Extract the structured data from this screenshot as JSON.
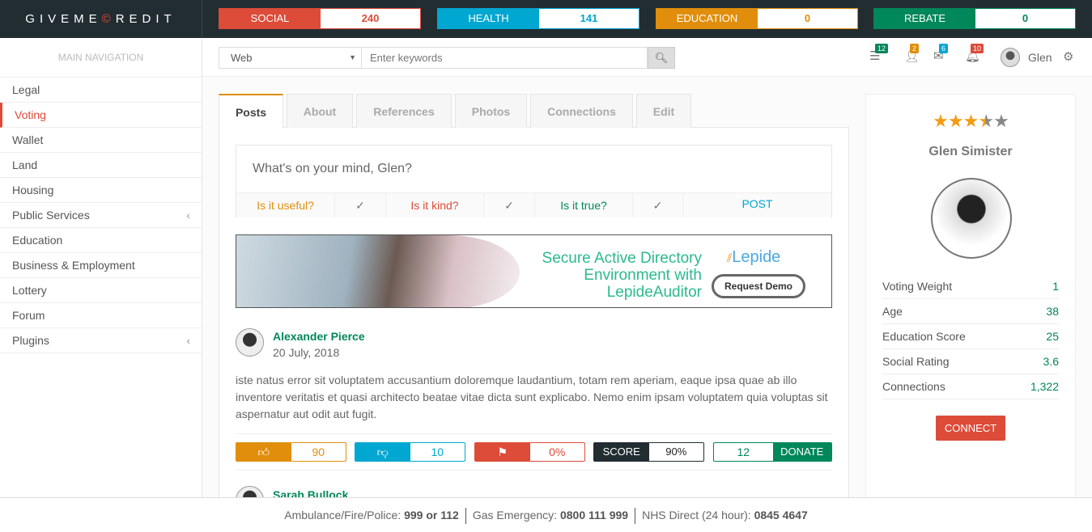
{
  "logo": {
    "pre": "GIVEME",
    "mark": "©",
    "post": "REDIT"
  },
  "stats": [
    {
      "label": "SOCIAL",
      "value": "240",
      "color": "#dd4b39"
    },
    {
      "label": "HEALTH",
      "value": "141",
      "color": "#00a7d0"
    },
    {
      "label": "EDUCATION",
      "value": "0",
      "color": "#e08e0b"
    },
    {
      "label": "REBATE",
      "value": "0",
      "color": "#00875a"
    }
  ],
  "sidebar": {
    "header": "MAIN NAVIGATION",
    "items": [
      {
        "label": "Legal"
      },
      {
        "label": "Voting",
        "active": true
      },
      {
        "label": "Wallet"
      },
      {
        "label": "Land"
      },
      {
        "label": "Housing"
      },
      {
        "label": "Public Services",
        "chevron": "‹"
      },
      {
        "label": "Education"
      },
      {
        "label": "Business & Employment"
      },
      {
        "label": "Lottery"
      },
      {
        "label": "Forum"
      },
      {
        "label": "Plugins",
        "chevron": "‹"
      }
    ]
  },
  "search": {
    "scope": "Web",
    "placeholder": "Enter keywords"
  },
  "topbar": {
    "badges": [
      "12",
      "2",
      "6",
      "10"
    ],
    "user": "Glen"
  },
  "tabs": [
    "Posts",
    "About",
    "References",
    "Photos",
    "Connections",
    "Edit"
  ],
  "composer": {
    "placeholder": "What's on your mind, Glen?",
    "q1": "Is it useful?",
    "q2": "Is it kind?",
    "q3": "Is it true?",
    "check": "✓",
    "post": "POST"
  },
  "ad": {
    "line1": "Secure Active Directory",
    "line2": "Environment with",
    "line3": "LepideAuditor",
    "brand": "Lepide",
    "cta": "Request Demo"
  },
  "post": {
    "author": "Alexander Pierce",
    "date": "20 July, 2018",
    "text": "iste natus error sit voluptatem accusantium doloremque laudantium, totam rem aperiam, eaque ipsa quae ab illo inventore veritatis et quasi architecto beatae vitae dicta sunt explicabo. Nemo enim ipsam voluptatem quia voluptas sit aspernatur aut odit aut fugit.",
    "likes": "90",
    "dislikes": "10",
    "flags": "0%",
    "score_label": "SCORE",
    "score": "90%",
    "donations": "12",
    "donate_label": "DONATE"
  },
  "next_post": {
    "author": "Sarah Bullock"
  },
  "profile": {
    "rating": 3.5,
    "rating_max": 5,
    "name": "Glen Simister",
    "rows": [
      {
        "label": "Voting Weight",
        "value": "1"
      },
      {
        "label": "Age",
        "value": "38"
      },
      {
        "label": "Education Score",
        "value": "25"
      },
      {
        "label": "Social Rating",
        "value": "3.6"
      },
      {
        "label": "Connections",
        "value": "1,322"
      }
    ],
    "connect": "CONNECT"
  },
  "footer": {
    "l1": "Ambulance/Fire/Police:",
    "v1": "999 or 112",
    "l2": "Gas Emergency:",
    "v2": "0800 111 999",
    "l3": "NHS Direct (24 hour):",
    "v3": "0845 4647"
  }
}
